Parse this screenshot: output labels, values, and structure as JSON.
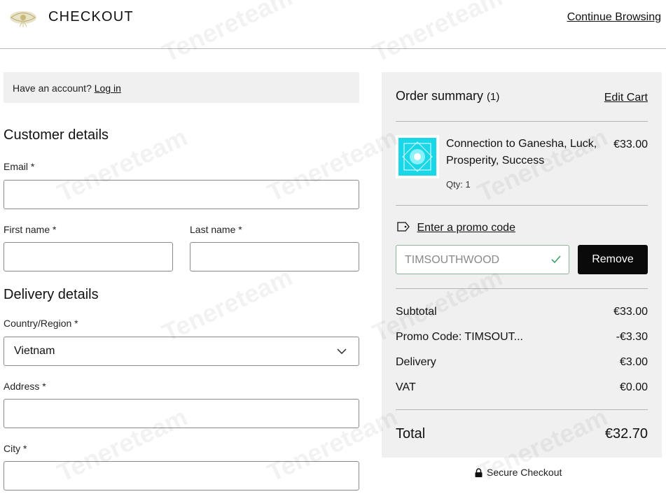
{
  "header": {
    "title": "CHECKOUT",
    "continue_label": "Continue Browsing"
  },
  "account": {
    "prompt": "Have an account?",
    "login_label": "Log in"
  },
  "customer": {
    "heading": "Customer details",
    "email_label": "Email *",
    "email_value": "",
    "first_name_label": "First name *",
    "first_name_value": "",
    "last_name_label": "Last name *",
    "last_name_value": ""
  },
  "delivery": {
    "heading": "Delivery details",
    "country_label": "Country/Region *",
    "country_value": "Vietnam",
    "address_label": "Address *",
    "address_value": "",
    "city_label": "City *",
    "city_value": ""
  },
  "summary": {
    "title": "Order summary",
    "count": "(1)",
    "edit_cart_label": "Edit Cart",
    "item": {
      "name": "Connection to Ganesha, Luck, Prosperity, Success",
      "price": "€33.00",
      "qty": "Qty: 1"
    },
    "promo": {
      "link_label": "Enter a promo code",
      "code": "TIMSOUTHWOOD",
      "remove_label": "Remove"
    },
    "rows": [
      {
        "label": "Subtotal",
        "value": "€33.00"
      },
      {
        "label": "Promo Code: TIMSOUT...",
        "value": "-€3.30"
      },
      {
        "label": "Delivery",
        "value": "€3.00"
      },
      {
        "label": "VAT",
        "value": "€0.00"
      }
    ],
    "total_label": "Total",
    "total_value": "€32.70"
  },
  "secure_label": "Secure Checkout",
  "watermark_text": "Tenereteam",
  "colors": {
    "panel_bg": "#f0f0f0",
    "button_bg": "#0a0a0a",
    "promo_border": "#8bb59a",
    "check_color": "#3aa06a",
    "thumb_color": "#19d7e6"
  },
  "icons": [
    "logo",
    "chevron-down-icon",
    "tag-icon",
    "check-icon",
    "lock-icon",
    "product-image"
  ]
}
